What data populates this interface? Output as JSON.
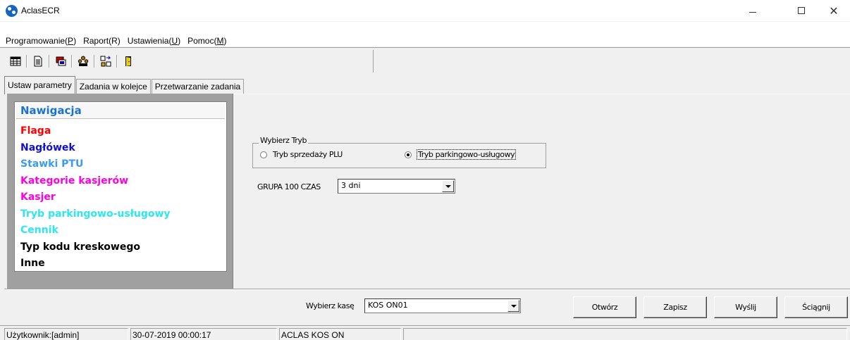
{
  "window": {
    "title": "AclasECR"
  },
  "menu": {
    "items": [
      {
        "text": "Programowanie(",
        "key": "P",
        "end": ")"
      },
      {
        "text": "Raport(R)",
        "key": "",
        "end": ""
      },
      {
        "text": "Ustawienia(",
        "key": "U",
        "end": ")"
      },
      {
        "text": "Pomoc(",
        "key": "M",
        "end": ")"
      }
    ]
  },
  "toolbar": {
    "icons": [
      "table-icon",
      "document-icon",
      "cards-icon",
      "people-icon",
      "transfer-icon",
      "exit-door-icon"
    ]
  },
  "tabs": [
    {
      "label": "Ustaw parametry",
      "active": true
    },
    {
      "label": "Zadania w kolejce",
      "active": false
    },
    {
      "label": "Przetwarzanie zadania",
      "active": false
    }
  ],
  "navigation": {
    "header": "Nawigacja",
    "header_color": "#1b73d1",
    "items": [
      {
        "label": "Flaga",
        "color": "#ff0000"
      },
      {
        "label": "Nagłówek",
        "color": "#1010d0"
      },
      {
        "label": "Stawki PTU",
        "color": "#3a9bef"
      },
      {
        "label": "Kategorie kasjerów",
        "color": "#ff00e0"
      },
      {
        "label": "Kasjer",
        "color": "#ff00e0"
      },
      {
        "label": "Tryb parkingowo-usługowy",
        "color": "#2ee6f0"
      },
      {
        "label": "Cennik",
        "color": "#2ee6f0"
      },
      {
        "label": "Typ kodu kreskowego",
        "color": "#000000"
      },
      {
        "label": "Inne",
        "color": "#000000"
      }
    ]
  },
  "mode_group": {
    "title": "Wybierz Tryb",
    "options": [
      {
        "label": "Tryb sprzedaży PLU",
        "checked": false
      },
      {
        "label": "Tryb parkingowo-usługowy",
        "checked": true
      }
    ]
  },
  "group100": {
    "label": "GRUPA 100 CZAS",
    "value": "3  dni"
  },
  "register": {
    "label": "Wybierz kasę",
    "value": "KOS ON01"
  },
  "buttons": {
    "open": "Otwórz",
    "save": "Zapisz",
    "send": "Wyślij",
    "download": "Ściągnij"
  },
  "status": {
    "user": "Użytkownik:[admin]",
    "datetime": "30-07-2019 00:00:17",
    "device": "ACLAS KOS ON"
  }
}
